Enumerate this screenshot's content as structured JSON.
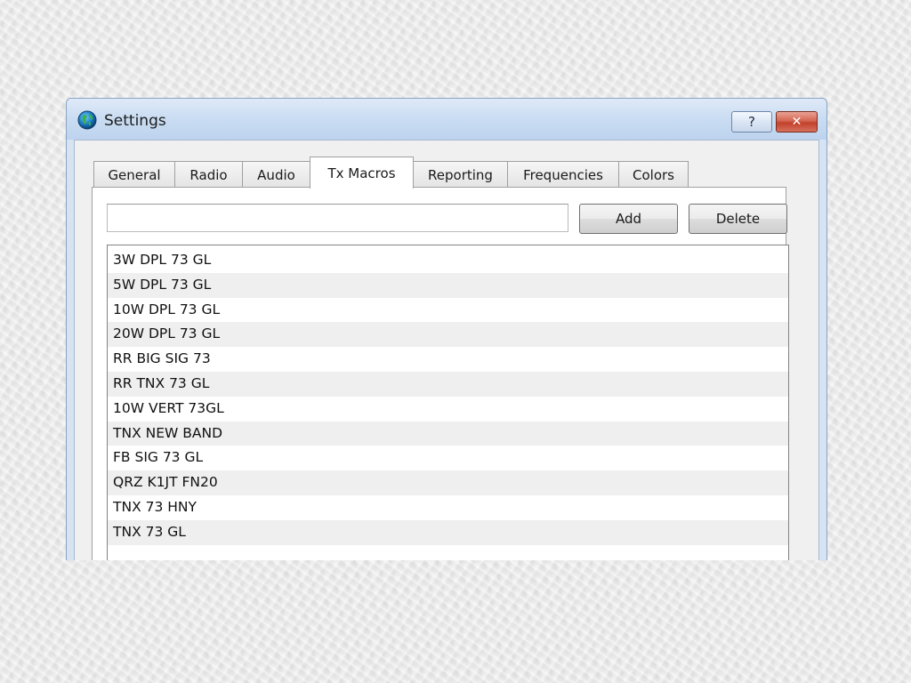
{
  "window": {
    "title": "Settings",
    "help_label": "?",
    "close_label": "✕"
  },
  "tabs": [
    {
      "label": "General",
      "active": false
    },
    {
      "label": "Radio",
      "active": false
    },
    {
      "label": "Audio",
      "active": false
    },
    {
      "label": "Tx Macros",
      "active": true
    },
    {
      "label": "Reporting",
      "active": false
    },
    {
      "label": "Frequencies",
      "active": false
    },
    {
      "label": "Colors",
      "active": false
    }
  ],
  "tx_macros": {
    "input_value": "",
    "add_label": "Add",
    "delete_label": "Delete",
    "items": [
      "3W DPL 73 GL",
      "5W DPL 73 GL",
      "10W DPL 73 GL",
      "20W DPL 73 GL",
      "RR BIG SIG 73",
      "RR TNX 73 GL",
      "10W VERT 73GL",
      "TNX NEW BAND",
      "FB SIG 73 GL",
      "QRZ K1JT FN20",
      "TNX 73 HNY",
      "TNX 73 GL"
    ]
  },
  "colors": {
    "close_button": "#c2412b",
    "titlebar": "#c9dcf2"
  }
}
